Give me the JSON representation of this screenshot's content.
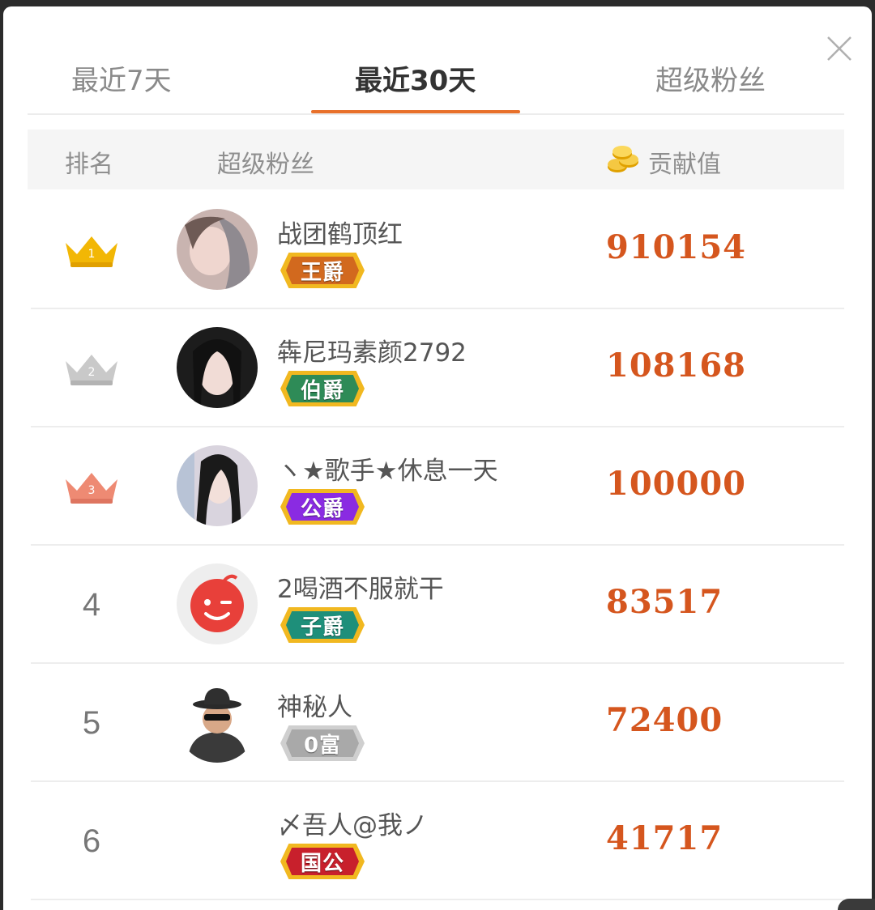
{
  "tabs": [
    {
      "label": "最近7天",
      "active": false
    },
    {
      "label": "最近30天",
      "active": true
    },
    {
      "label": "超级粉丝",
      "active": false
    }
  ],
  "table_header": {
    "rank": "排名",
    "fan": "超级粉丝",
    "contribution": "贡献值",
    "contribution_icon": "gold-coins-icon"
  },
  "rows": [
    {
      "rank": "1",
      "rank_icon": "gold-crown-icon",
      "name": "战团鹤顶红",
      "badge": "王爵",
      "badge_color": "#d2691e",
      "value": "910154"
    },
    {
      "rank": "2",
      "rank_icon": "silver-crown-icon",
      "name": "犇尼玛素颜2792",
      "badge": "伯爵",
      "badge_color": "#2e8b57",
      "value": "108168"
    },
    {
      "rank": "3",
      "rank_icon": "bronze-crown-icon",
      "name": "ヽ★歌手★休息一天",
      "badge": "公爵",
      "badge_color": "#8a2be2",
      "value": "100000"
    },
    {
      "rank": "4",
      "name": "2喝酒不服就干",
      "badge": "子爵",
      "badge_color": "#1e8f7a",
      "value": "83517"
    },
    {
      "rank": "5",
      "name": "神秘人",
      "badge": "0富",
      "badge_color": "#a9a9a9",
      "value": "72400"
    },
    {
      "rank": "6",
      "name": "〆吾人@我ノ",
      "badge": "国公",
      "badge_color": "#c8202c",
      "value": "41717"
    }
  ],
  "colors": {
    "accent": "#e8702a",
    "value_text": "#d5561e",
    "crown_gold": "#f2b705",
    "crown_silver": "#c9c9c9",
    "crown_bronze": "#ee8a73"
  }
}
